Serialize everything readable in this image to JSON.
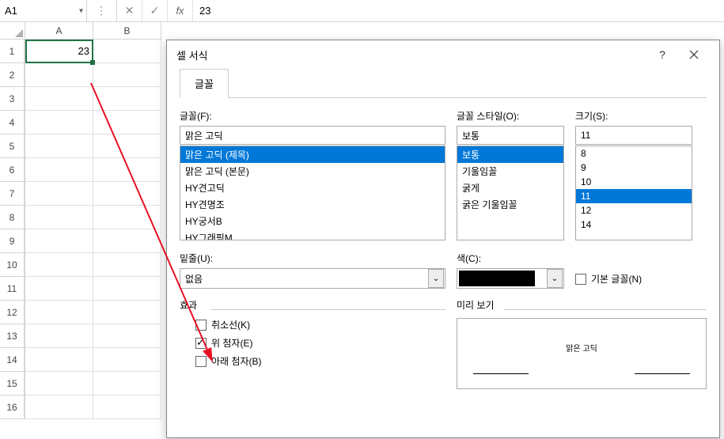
{
  "namebox": {
    "value": "A1"
  },
  "formula": {
    "value": "23"
  },
  "fx_label": "fx",
  "columns": [
    "A",
    "B"
  ],
  "rows": [
    "1",
    "2",
    "3",
    "4",
    "5",
    "6",
    "7",
    "8",
    "9",
    "10",
    "11",
    "12",
    "13",
    "14",
    "15",
    "16"
  ],
  "cell_a1": "23",
  "dialog": {
    "title": "셀 서식",
    "tab_font": "글꼴",
    "labels": {
      "font": "글꼴(F):",
      "style": "글꼴 스타일(O):",
      "size": "크기(S):",
      "underline": "밑줄(U):",
      "color": "색(C):",
      "default_font": "기본 글꼴(N)",
      "effects": "효과",
      "preview": "미리 보기"
    },
    "font_input": "맑은 고딕",
    "font_list": [
      "맑은 고딕 (제목)",
      "맑은 고딕 (본문)",
      "HY견고딕",
      "HY견명조",
      "HY궁서B",
      "HY그래픽M"
    ],
    "font_selected_index": 0,
    "style_input": "보통",
    "style_list": [
      "보통",
      "기울임꼴",
      "굵게",
      "굵은 기울임꼴"
    ],
    "style_selected_index": 0,
    "size_input": "11",
    "size_list": [
      "8",
      "9",
      "10",
      "11",
      "12",
      "14"
    ],
    "size_selected_index": 3,
    "underline_value": "없음",
    "color_value": "#000000",
    "default_font_checked": false,
    "effects": {
      "strike": {
        "label": "취소선(K)",
        "checked": false
      },
      "super": {
        "label": "위 첨자(E)",
        "checked": true
      },
      "sub": {
        "label": "아래 첨자(B)",
        "checked": false
      }
    },
    "preview_text": "맑은 고딕"
  }
}
